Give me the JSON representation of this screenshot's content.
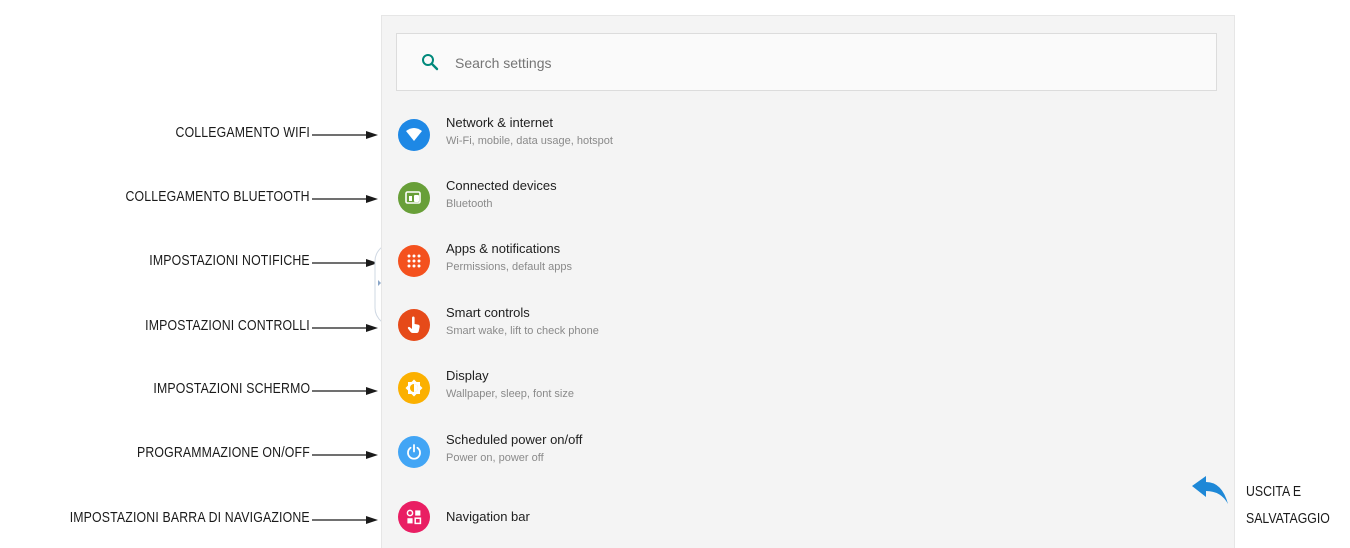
{
  "search": {
    "placeholder": "Search settings"
  },
  "items": [
    {
      "title": "Network & internet",
      "subtitle": "Wi-Fi, mobile, data usage, hotspot",
      "icon": "wifi-icon",
      "color": "#1e88e5"
    },
    {
      "title": "Connected devices",
      "subtitle": "Bluetooth",
      "icon": "devices-icon",
      "color": "#689f38"
    },
    {
      "title": "Apps & notifications",
      "subtitle": "Permissions, default apps",
      "icon": "apps-grid-icon",
      "color": "#f4511e"
    },
    {
      "title": "Smart controls",
      "subtitle": "Smart wake, lift to check phone",
      "icon": "hand-gesture-icon",
      "color": "#e64a19"
    },
    {
      "title": "Display",
      "subtitle": "Wallpaper, sleep, font size",
      "icon": "brightness-icon",
      "color": "#fbb000"
    },
    {
      "title": "Scheduled power on/off",
      "subtitle": "Power on, power off",
      "icon": "power-icon",
      "color": "#42a5f5"
    },
    {
      "title": "Navigation bar",
      "subtitle": "",
      "icon": "navigation-bar-icon",
      "color": "#e91e63"
    }
  ],
  "annotations": [
    "COLLEGAMENTO WIFI",
    "COLLEGAMENTO BLUETOOTH",
    "IMPOSTAZIONI NOTIFICHE",
    "IMPOSTAZIONI CONTROLLI",
    "IMPOSTAZIONI SCHERMO",
    "PROGRAMMAZIONE ON/OFF",
    "IMPOSTAZIONI BARRA DI NAVIGAZIONE"
  ],
  "exit": {
    "line1": "USCITA E",
    "line2": "SALVATAGGIO",
    "icon": "back-arrow-icon",
    "color": "#1e88d7"
  }
}
